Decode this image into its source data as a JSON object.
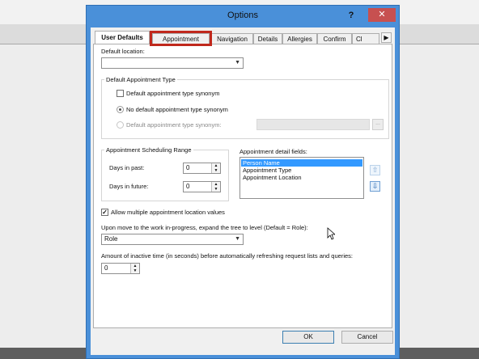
{
  "window": {
    "title": "Options",
    "help": "?",
    "close": "✕"
  },
  "tabs": [
    "User Defaults",
    "Appointment",
    "Navigation",
    "Details",
    "Allergies",
    "Confirm",
    "Cl"
  ],
  "tab_scroll": "▶",
  "default_location": {
    "label": "Default location:",
    "value": ""
  },
  "default_appointment_type": {
    "title": "Default Appointment Type",
    "checkbox_label": "Default appointment type synonym",
    "radio_none_label": "No default appointment type synonym",
    "radio_synonym_label": "Default appointment type synonym:",
    "browse_label": "..."
  },
  "scheduling_range": {
    "title": "Appointment Scheduling Range",
    "days_past_label": "Days in past:",
    "days_past_value": "0",
    "days_future_label": "Days in future:",
    "days_future_value": "0"
  },
  "detail_fields": {
    "label": "Appointment detail fields:",
    "items": [
      "Person Name",
      "Appointment Type",
      "Appointment Location"
    ],
    "selected_index": 0
  },
  "allow_multiple": {
    "label": "Allow multiple appointment location values",
    "checked": true
  },
  "expand_tree": {
    "label": "Upon move to the work in-progress, expand the tree to level (Default = Role):",
    "value": "Role"
  },
  "inactive_time": {
    "label": "Amount of inactive time (in seconds) before automatically refreshing request lists and queries:",
    "value": "0"
  },
  "buttons": {
    "ok": "OK",
    "cancel": "Cancel"
  },
  "colors": {
    "titlebar": "#4a90d9",
    "close": "#c75050",
    "highlight": "#c0281c",
    "selection": "#3399ff"
  }
}
